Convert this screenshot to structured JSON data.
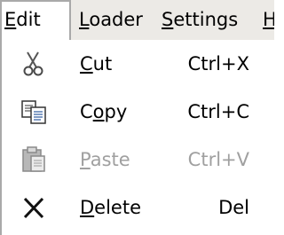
{
  "menubar": {
    "items": [
      {
        "label": "Edit",
        "mnemonic_first": "E",
        "rest": "dit"
      },
      {
        "label": "Loader",
        "mnemonic_first": "L",
        "rest": "oader"
      },
      {
        "label": "Settings",
        "mnemonic_first": "S",
        "rest": "ettings"
      },
      {
        "label": "H",
        "mnemonic_first": "H",
        "rest": ""
      }
    ]
  },
  "menu": {
    "items": [
      {
        "label_pre": "",
        "mnemonic": "C",
        "label_post": "ut",
        "shortcut": "Ctrl+X",
        "icon": "scissors-icon",
        "enabled": true
      },
      {
        "label_pre": "C",
        "mnemonic": "o",
        "label_post": "py",
        "shortcut": "Ctrl+C",
        "icon": "copy-icon",
        "enabled": true
      },
      {
        "label_pre": "",
        "mnemonic": "P",
        "label_post": "aste",
        "shortcut": "Ctrl+V",
        "icon": "clipboard-icon",
        "enabled": false
      },
      {
        "label_pre": "",
        "mnemonic": "D",
        "label_post": "elete",
        "shortcut": "Del",
        "icon": "delete-x-icon",
        "enabled": true
      }
    ]
  },
  "colors": {
    "menubar_bg": "#eceae6",
    "open_border": "#a9a9a9",
    "disabled_text": "#a0a0a0"
  }
}
